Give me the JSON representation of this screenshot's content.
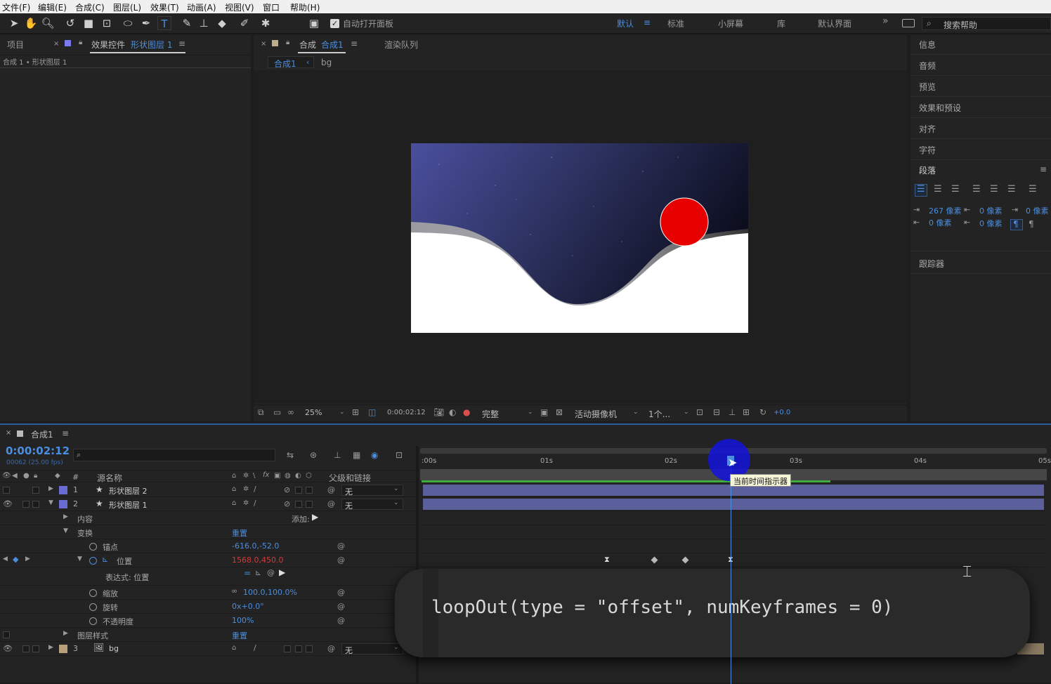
{
  "menu": [
    "文件(F)",
    "编辑(E)",
    "合成(C)",
    "图层(L)",
    "效果(T)",
    "动画(A)",
    "视图(V)",
    "窗口",
    "帮助(H)"
  ],
  "toolbar": {
    "auto_open_label": "自动打开面板",
    "workspaces": [
      "默认",
      "标准",
      "小屏幕",
      "库",
      "默认界面"
    ],
    "more": "»",
    "search_placeholder": "搜索帮助"
  },
  "left_panel": {
    "tab_project": "项目",
    "tab_effects": "效果控件",
    "tab_effects_target": "形状图层 1",
    "breadcrumb": "合成 1 • 形状图层 1"
  },
  "comp_panel": {
    "tab_label": "合成",
    "tab_name": "合成1",
    "render_queue": "渲染队列",
    "sub_tabs": [
      "合成1",
      "bg"
    ],
    "zoom": "25%",
    "timecode": "0:00:02:12",
    "resolution": "完整",
    "camera": "活动摄像机",
    "views": "1个...",
    "exposure": "+0.0"
  },
  "right_panel": {
    "items": [
      "信息",
      "音频",
      "预览",
      "效果和预设",
      "对齐",
      "字符"
    ],
    "paragraph_title": "段落",
    "indent_left": "267 像素",
    "space_before": "0 像素",
    "indent_right": "0 像素",
    "indent_first": "0 像素",
    "space_after": "0 像素",
    "tracker": "跟踪器"
  },
  "timeline": {
    "tab": "合成1",
    "time": "0:00:02:12",
    "frame_info": "00062 (25.00 fps)",
    "col_num": "#",
    "col_source": "源名称",
    "col_parent": "父级和链接",
    "ruler": [
      ":00s",
      "01s",
      "02s",
      "03s",
      "04s",
      "05s"
    ],
    "tooltip": "当前时间指示器",
    "add_label": "添加:",
    "layers": [
      {
        "num": "1",
        "name": "形状图层 2",
        "parent": "无",
        "color": "#6b6bd6"
      },
      {
        "num": "2",
        "name": "形状图层 1",
        "parent": "无",
        "color": "#6b6bd6"
      },
      {
        "num": "3",
        "name": "bg",
        "parent": "无",
        "color": "#b8a17a"
      }
    ],
    "props": {
      "contents": "内容",
      "transform": "变换",
      "reset": "重置",
      "anchor": "锚点",
      "anchor_val": "-616.0,-52.0",
      "position": "位置",
      "position_val": "1568.0,450.0",
      "expression": "表达式: 位置",
      "scale": "缩放",
      "scale_val": "100.0,100.0%",
      "rotation": "旋转",
      "rotation_val": "0x+0.0°",
      "opacity": "不透明度",
      "opacity_val": "100%",
      "layer_styles": "图层样式",
      "reset2": "重置"
    },
    "expression_text": "loopOut(type = \"offset\", numKeyframes = 0)"
  }
}
